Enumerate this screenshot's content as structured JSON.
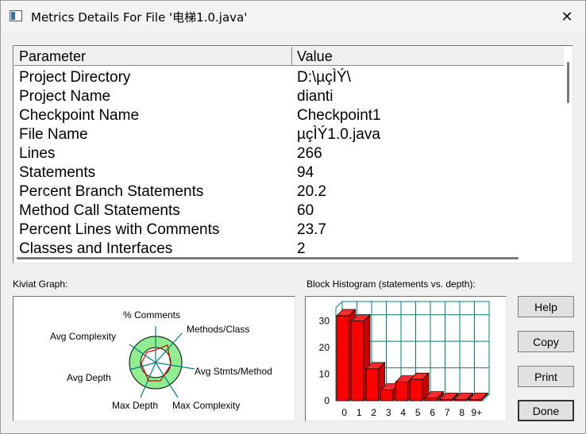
{
  "window": {
    "title": "Metrics Details For File '电梯1.0.java'",
    "close_glyph": "✕"
  },
  "table": {
    "headers": [
      "Parameter",
      "Value"
    ],
    "rows": [
      {
        "param": "Project Directory",
        "value": "D:\\µçÌÝ\\"
      },
      {
        "param": "Project Name",
        "value": "dianti"
      },
      {
        "param": "Checkpoint Name",
        "value": "Checkpoint1"
      },
      {
        "param": "File Name",
        "value": "µçÌÝ1.0.java"
      },
      {
        "param": "Lines",
        "value": "266"
      },
      {
        "param": "Statements",
        "value": "94"
      },
      {
        "param": "Percent Branch Statements",
        "value": "20.2"
      },
      {
        "param": "Method Call Statements",
        "value": "60"
      },
      {
        "param": "Percent Lines with Comments",
        "value": "23.7"
      },
      {
        "param": "Classes and Interfaces",
        "value": "2"
      }
    ]
  },
  "kiviat": {
    "label": "Kiviat Graph:",
    "axes": [
      "% Comments",
      "Methods/Class",
      "Avg Stmts/Method",
      "Max Complexity",
      "Max Depth",
      "Avg Depth",
      "Avg Complexity"
    ]
  },
  "histogram": {
    "label": "Block Histogram (statements vs. depth):"
  },
  "buttons": {
    "help": "Help",
    "copy": "Copy",
    "print": "Print",
    "done": "Done"
  },
  "colors": {
    "bar": "#ff0000",
    "kiviat_ring": "#90ee90",
    "axis": "#008080"
  },
  "chart_data": {
    "type": "bar",
    "title": "Block Histogram (statements vs. depth):",
    "categories": [
      "0",
      "1",
      "2",
      "3",
      "4",
      "5",
      "6",
      "7",
      "8",
      "9+"
    ],
    "values": [
      32,
      30,
      12,
      4,
      7,
      8,
      1,
      0,
      0,
      0
    ],
    "yticks": [
      "0",
      "10",
      "20",
      "30"
    ],
    "ylim": [
      0,
      35
    ],
    "grid": true
  }
}
